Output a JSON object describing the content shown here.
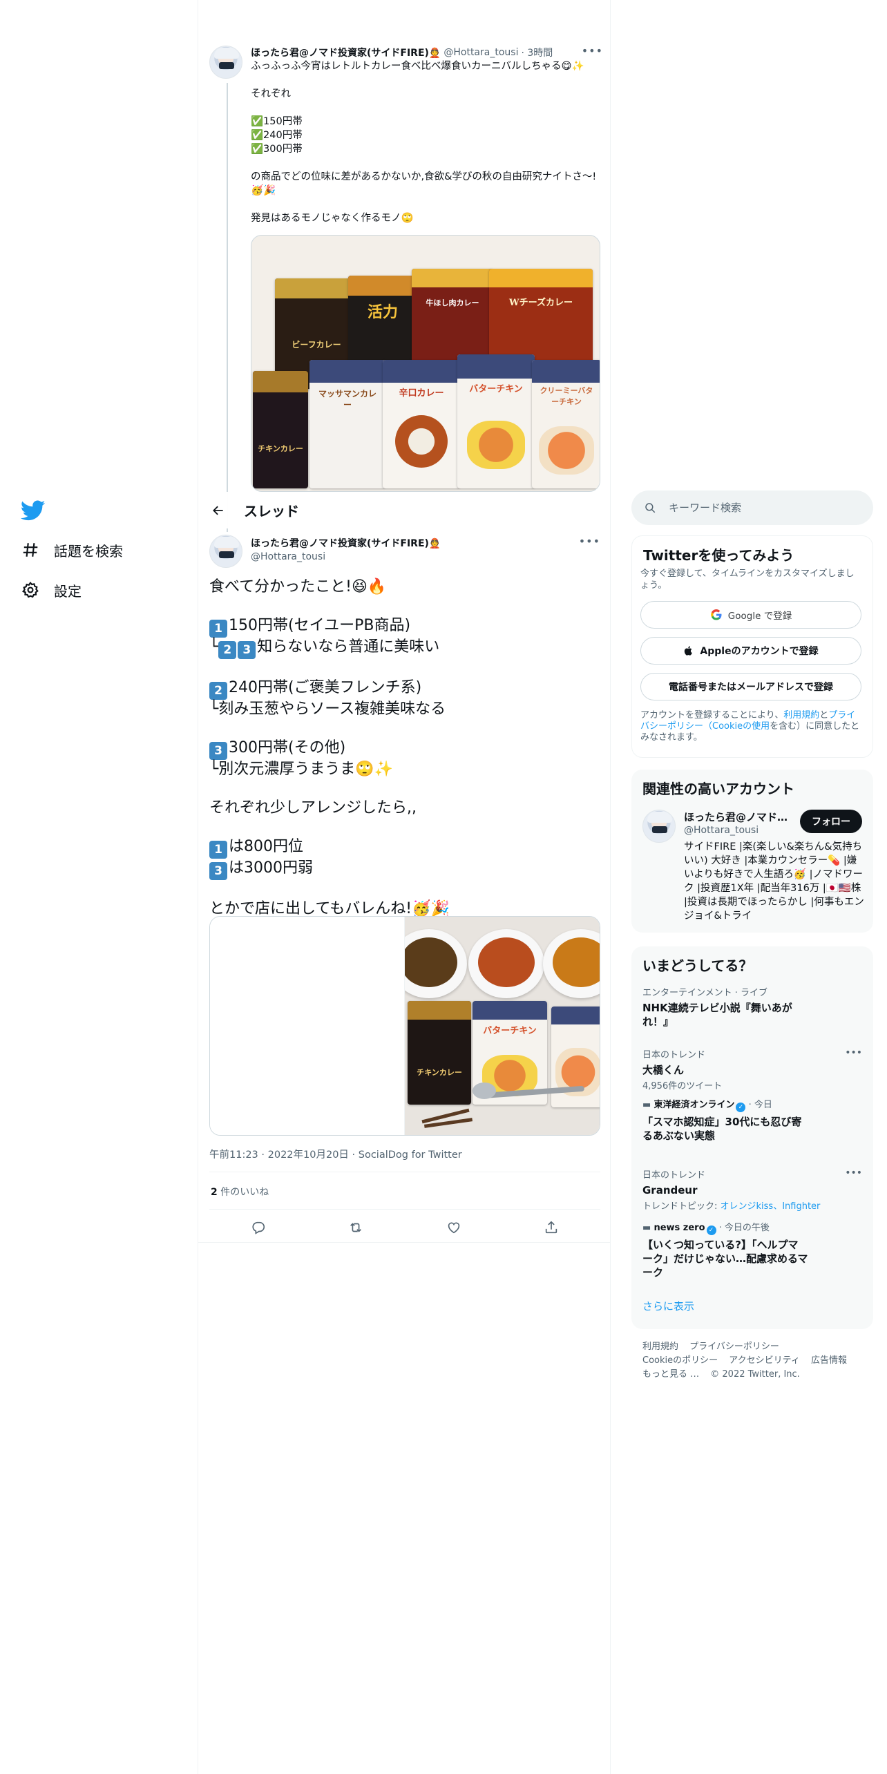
{
  "nav": {
    "explore_label": "話題を検索",
    "settings_label": "設定"
  },
  "parent_tweet": {
    "name": "ほったら君@ノマド投資家(サイドFIRE)👲",
    "handle": "@Hottara_tousi",
    "time": "· 3時間",
    "lines": [
      "ふっふっふ今宵はレトルトカレー食べ比べ爆食いカーニバルしちゃる😋✨",
      "",
      "それぞれ",
      "",
      "✅150円帯",
      "✅240円帯",
      "✅300円帯",
      "",
      "の商品でどの位味に差があるかないか,食欲&学びの秋の自由研究ナイトさ〜!🥳🎉",
      "",
      "発見はあるモノじゃなく作るモノ🙄"
    ],
    "photo_labels": [
      "活力",
      "牛ほし肉カレー",
      "Wチーズカレー",
      "ビーフカレー",
      "チキンカレー",
      "マッサマンカレー",
      "辛口カレー",
      "バターチキン",
      "クリーミーバターチキン"
    ]
  },
  "header": {
    "title": "スレッド"
  },
  "main_tweet": {
    "name": "ほったら君@ノマド投資家(サイドFIRE)👲",
    "handle": "@Hottara_tousi",
    "line1": "食べて分かったこと!😆🔥",
    "k1": "1",
    "line2": "150円帯(セイユーPB商品)",
    "line3_prefix": "└",
    "k2": "2",
    "k3": "3",
    "line3": "知らないなら普通に美味い",
    "line4": "240円帯(ご褒美フレンチ系)",
    "line5": "└刻み玉葱やらソース複雑美味なる",
    "line6": "300円帯(その他)",
    "line7": "└別次元濃厚うまうま🙄✨",
    "line8": "それぞれ少しアレンジしたら,,",
    "line9": "は800円位",
    "line10": "は3000円弱",
    "line11": "とかで店に出してもバレんね!🥳🎉",
    "photo_labels": [
      "チキンカレー",
      "バターチキン"
    ],
    "meta_time": "午前11:23 · 2022年10月20日 · SocialDog for Twitter",
    "likes_count": "2",
    "likes_label": "件のいいね"
  },
  "search": {
    "placeholder": "キーワード検索"
  },
  "signup": {
    "title": "Twitterを使ってみよう",
    "subtitle": "今すぐ登録して、タイムラインをカスタマイズしましょう。",
    "google": "Google で登録",
    "apple": "Appleのアカウントで登録",
    "phone": "電話番号またはメールアドレスで登録",
    "legal_prefix": "アカウントを登録することにより、",
    "legal_terms": "利用規約",
    "legal_and": "と",
    "legal_privacy": "プライバシーポリシー（Cookieの使用",
    "legal_suffix": "を含む）に同意したとみなされます。"
  },
  "related": {
    "title": "関連性の高いアカウント",
    "name": "ほったら君@ノマド投資家(サイドFIRE)",
    "handle": "@Hottara_tousi",
    "follow": "フォロー",
    "bio": "サイドFIRE |楽(楽しい&楽ちん&気持ちいい) 大好き |本業カウンセラー💊 |嫌いよりも好きで人生語ろ🥳 |ノマドワーク |投資歴1X年 |配当年316万 |🇯🇵🇺🇸株 |投資は長期でほったらかし |何事もエンジョイ&トライ"
  },
  "trends": {
    "title": "いまどうしてる？",
    "items": [
      {
        "context": "エンターテインメント · ライブ",
        "title": "NHK連続テレビ小説『舞いあがれ！』"
      },
      {
        "context": "日本のトレンド",
        "title": "大橋くん",
        "count": "4,956件のツイート"
      },
      {
        "source": "東洋経済オンライン",
        "context": "· 今日",
        "title": "「スマホ認知症」30代にも忍び寄るあぶない実態"
      },
      {
        "context": "日本のトレンド",
        "title": "Grandeur",
        "topic_prefix": "トレンドトピック: ",
        "topic_links": "オレンジkiss、Infighter"
      },
      {
        "source": "news zero",
        "context": "· 今日の午後",
        "title": "【いくつ知っている?】「ヘルプマーク」だけじゃない…配慮求めるマーク"
      }
    ],
    "more": "さらに表示"
  },
  "footer": {
    "links": [
      "利用規約",
      "プライバシーポリシー",
      "Cookieのポリシー",
      "アクセシビリティ",
      "広告情報",
      "もっと見る …"
    ],
    "copyright": "© 2022 Twitter, Inc."
  },
  "colors": {
    "accent": "#1d9bf0",
    "text": "#0f1419",
    "muted": "#536471",
    "keycap": "#3b88c3"
  }
}
